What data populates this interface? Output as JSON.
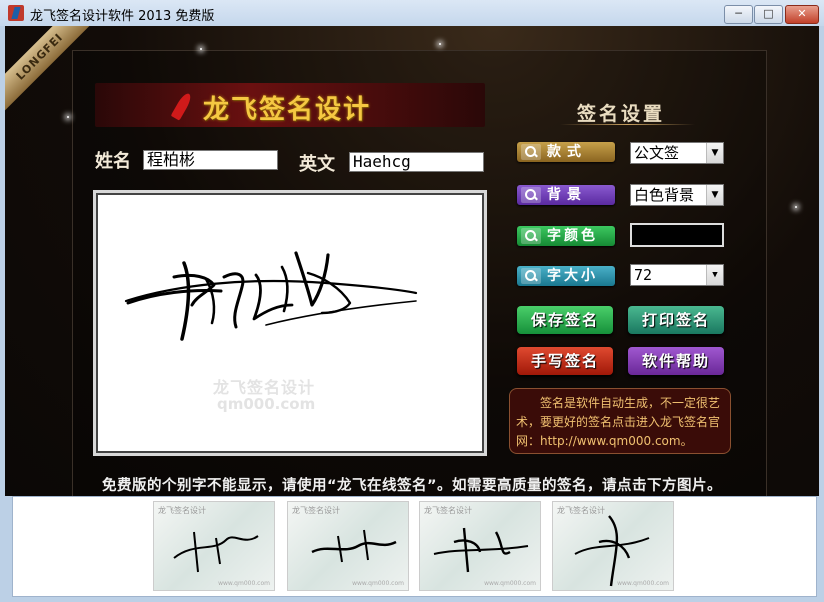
{
  "window": {
    "title": "龙飞签名设计软件 2013 免费版",
    "min_label": "─",
    "max_label": "□",
    "close_label": "✕"
  },
  "brand": {
    "ribbon_text": "LONGFEI",
    "banner_title": "龙飞签名设计"
  },
  "form": {
    "name_label": "姓名",
    "name_value": "程柏彬",
    "english_label": "英文",
    "english_value": "Haehcg"
  },
  "canvas": {
    "watermark_line1": "龙飞签名设计",
    "watermark_line2": "qm000.com"
  },
  "settings": {
    "title": "签名设置",
    "style_label": "款式",
    "style_value": "公文签",
    "background_label": "背景",
    "background_value": "白色背景",
    "font_color_label": "字颜色",
    "font_color_value": "#000000",
    "font_size_label": "字大小",
    "font_size_value": "72"
  },
  "actions": {
    "save": "保存签名",
    "print": "打印签名",
    "handwrite": "手写签名",
    "help": "软件帮助"
  },
  "notice": "　　签名是软件自动生成，不一定很艺术，要更好的签名点击进入龙飞签名官网：http://www.qm000.com。",
  "bottom_text": "免费版的个别字不能显示，请使用“龙飞在线签名”。如需要高质量的签名，请点击下方图片。",
  "thumbnails": [
    {
      "caption": "龙飞签名设计",
      "footer": "www.qm000.com"
    },
    {
      "caption": "龙飞签名设计",
      "footer": "www.qm000.com"
    },
    {
      "caption": "龙飞签名设计",
      "footer": "www.qm000.com"
    },
    {
      "caption": "龙飞签名设计",
      "footer": "www.qm000.com"
    }
  ]
}
